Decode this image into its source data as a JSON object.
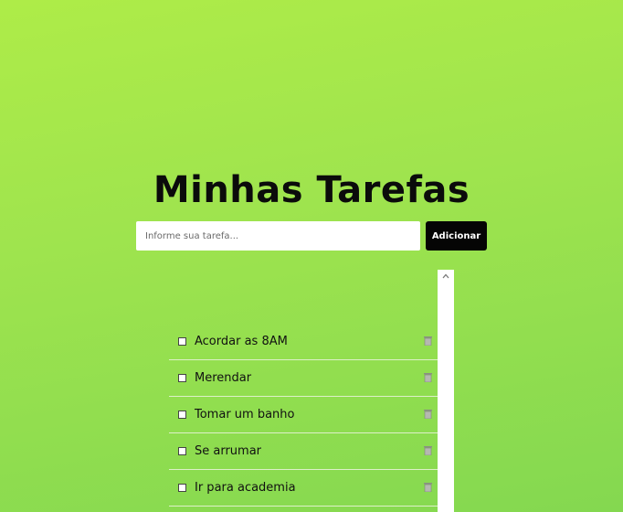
{
  "app": {
    "title": "Minhas Tarefas"
  },
  "form": {
    "input_value": "",
    "input_placeholder": "Informe sua tarefa...",
    "add_label": "Adicionar"
  },
  "tasks": [
    {
      "label": "Acordar as 8AM",
      "checked": false
    },
    {
      "label": "Merendar",
      "checked": false
    },
    {
      "label": "Tomar um banho",
      "checked": false
    },
    {
      "label": "Se arrumar",
      "checked": false
    },
    {
      "label": "Ir para academia",
      "checked": false
    }
  ],
  "icons": {
    "delete": "trash-icon",
    "scroll_up": "chevron-up-icon"
  },
  "colors": {
    "background_start": "#aeec48",
    "background_end": "#84d850",
    "button_bg": "#050505",
    "button_text": "#ffffff",
    "title_text": "#0b0b0b"
  }
}
